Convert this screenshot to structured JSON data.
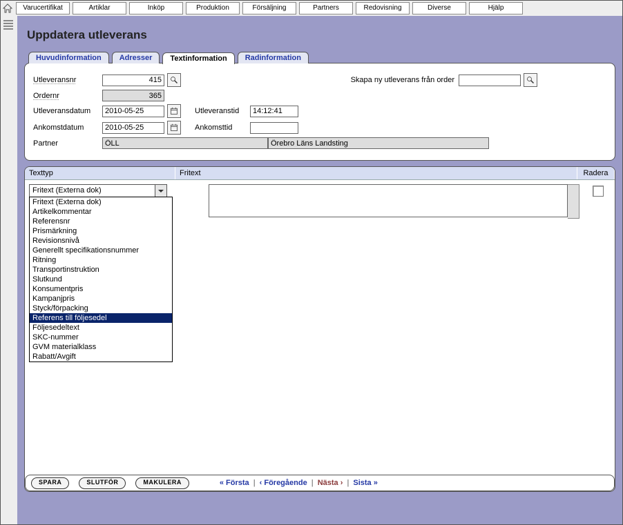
{
  "menu": [
    "Varucertifikat",
    "Artiklar",
    "Inköp",
    "Produktion",
    "Försäljning",
    "Partners",
    "Redovisning",
    "Diverse",
    "Hjälp"
  ],
  "page": {
    "title": "Uppdatera utleverans"
  },
  "tabs": {
    "t1": "Huvudinformation",
    "t2": "Adresser",
    "t3": "Textinformation",
    "t4": "Radinformation"
  },
  "form": {
    "utleveransnr_lbl": "Utleveransnr",
    "utleveransnr_val": "415",
    "ordernr_lbl": "Ordernr",
    "ordernr_val": "365",
    "utlevdatum_lbl": "Utleveransdatum",
    "utlevdatum_val": "2010-05-25",
    "utlevtid_lbl": "Utleveranstid",
    "utlevtid_val": "14:12:41",
    "ankdatum_lbl": "Ankomstdatum",
    "ankdatum_val": "2010-05-25",
    "anktid_lbl": "Ankomsttid",
    "anktid_val": "",
    "partner_lbl": "Partner",
    "partner_code": "ÖLL",
    "partner_name": "Örebro Läns Landsting",
    "neworder_lbl": "Skapa ny utleverans från order",
    "neworder_val": ""
  },
  "list": {
    "hdr_texttyp": "Texttyp",
    "hdr_fritext": "Fritext",
    "hdr_radera": "Radera",
    "dd_value": "Fritext (Externa dok)",
    "dd_items": [
      "Fritext (Externa dok)",
      "Artikelkommentar",
      "Referensnr",
      "Prismärkning",
      "Revisionsnivå",
      "Generellt specifikationsnummer",
      "Ritning",
      "Transportinstruktion",
      "Slutkund",
      "Konsumentpris",
      "Kampanjpris",
      "Styck/förpacking",
      "Referens till följesedel",
      "Följesedeltext",
      "SKC-nummer",
      "GVM materialklass",
      "Rabatt/Avgift"
    ],
    "dd_selected_index": 12,
    "fritext_val": ""
  },
  "footer": {
    "spara": "SPARA",
    "slutfor": "SLUTFÖR",
    "makulera": "MAKULERA",
    "nav_first": "« Första",
    "nav_prev": "‹ Föregående",
    "nav_next": "Nästa ›",
    "nav_last": "Sista »"
  }
}
